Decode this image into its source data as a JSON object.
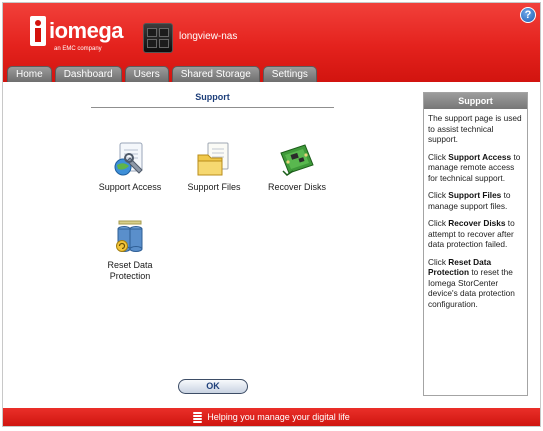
{
  "header": {
    "brand_name": "iomega",
    "brand_tagline": "an EMC company",
    "device_name": "longview-nas",
    "help_label": "?"
  },
  "tabs": [
    {
      "label": "Home"
    },
    {
      "label": "Dashboard"
    },
    {
      "label": "Users"
    },
    {
      "label": "Shared Storage"
    },
    {
      "label": "Settings"
    }
  ],
  "main": {
    "title": "Support",
    "tools": [
      {
        "label": "Support Access",
        "icon": "wrench-network-icon"
      },
      {
        "label": "Support Files",
        "icon": "folder-documents-icon"
      },
      {
        "label": "Recover Disks",
        "icon": "circuit-board-icon"
      },
      {
        "label": "Reset Data Protection",
        "icon": "database-reset-icon"
      }
    ],
    "ok_label": "OK"
  },
  "side_panel": {
    "title": "Support",
    "intro": "The support page is used to assist technical support.",
    "items": [
      {
        "pre": "Click ",
        "term": "Support Access",
        "post": " to manage remote access for technical support."
      },
      {
        "pre": "Click ",
        "term": "Support Files",
        "post": " to manage support files."
      },
      {
        "pre": "Click ",
        "term": "Recover Disks",
        "post": " to attempt to recover after data protection failed."
      },
      {
        "pre": "Click ",
        "term": "Reset Data Protection",
        "post": " to reset the Iomega StorCenter device's data protection configuration."
      }
    ]
  },
  "footer": {
    "text": "Helping you manage your digital life"
  },
  "colors": {
    "brand_red": "#e4221d",
    "tab_grey": "#8a8a8a",
    "title_blue": "#1e3f7a"
  }
}
